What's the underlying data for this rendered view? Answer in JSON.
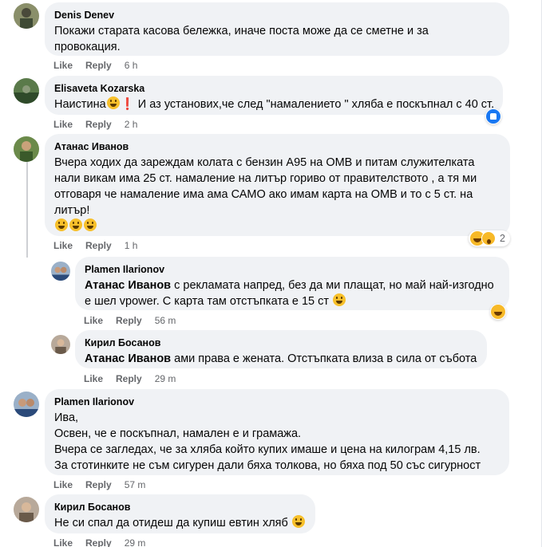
{
  "actions": {
    "like": "Like",
    "reply": "Reply"
  },
  "comments": [
    {
      "author": "Denis Denev",
      "lines": [
        "Покажи старата касова бележка, иначе поста може да се сметне и за",
        "провокация."
      ],
      "time": "6 h"
    },
    {
      "author": "Elisaveta Kozarska",
      "text_before": "Наистина",
      "excl": "❗",
      "text_after": "И аз установих,че след \"намалението \" хляба е поскъпнал с 40 ст.",
      "time": "2 h",
      "reaction_icon": "like-reaction-icon"
    },
    {
      "author": "Атанас Иванов",
      "lines": [
        "Вчера ходих да зареждам колата с бензин А95 на ОМВ и питам служителката",
        "нали викам има 25 ст. намаление на литър гориво от правителството , а тя ми",
        "отговаря че намаление има ама САМО ако имам карта на ОМВ и то с 5 ст. на",
        "литър!"
      ],
      "time": "1 h",
      "reaction_count": "2"
    },
    {
      "author": "Plamen Ilarionov",
      "mention": "Атанас Иванов",
      "line1": " с рекламата напред, без да ми плащат, но май най-изгодно",
      "line2": "е шел vpower. С карта там отстъпката е 15 ст",
      "time": "56 m"
    },
    {
      "author": "Кирил Босанов",
      "mention": "Атанас Иванов",
      "text": " ами права е жената. Отстъпката влиза в сила от събота",
      "time": "29 m"
    },
    {
      "author": "Plamen Ilarionov",
      "lines": [
        "Ива,",
        "Освен, че е поскъпнал, намален е и грамажа.",
        "Вчера се загледах, че за хляба който купих имаше и цена на килограм 4,15 лв.",
        "За стотинките не съм сигурен дали бяха толкова, но бяха под 50 със сигурност"
      ],
      "time": "57 m"
    },
    {
      "author": "Кирил Босанов",
      "text": "Не си спал да отидеш да купиш евтин хляб",
      "time": "29 m"
    }
  ]
}
